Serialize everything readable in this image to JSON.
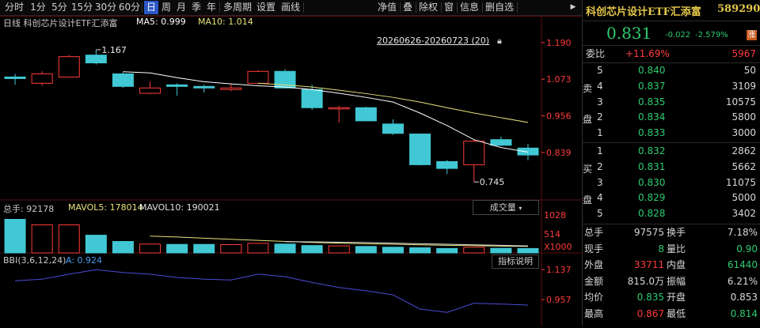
{
  "toolbar": {
    "left_items": [
      "分时",
      "1分",
      "5分",
      "15分",
      "30分",
      "60分",
      "日",
      "周",
      "月",
      "季",
      "年",
      "多周期",
      "设置",
      "画线"
    ],
    "active": "日",
    "right_items": [
      "净值",
      "叠",
      "除权",
      "窗",
      "信息",
      "删自选"
    ]
  },
  "legend_main": {
    "name": "日线  科创芯片设计ETF汇添富",
    "ma5_label": "MA5: 0.999",
    "ma10_label": "MA10: 1.014"
  },
  "date_range": "20260626-20260723 (20)",
  "price_axis": {
    "ticks": [
      "1.190",
      "1.073",
      "0.956",
      "0.839"
    ]
  },
  "annotations": {
    "high": "1.167",
    "low": "0.745"
  },
  "legend_volume": {
    "total": "总手: 92178",
    "mavol5": "MAVOL5: 178014",
    "mavol10": "MAVOL10: 190021"
  },
  "volume_button": "成交量",
  "volume_axis": {
    "ticks": [
      "1028",
      "514",
      "X1000"
    ]
  },
  "legend_bbi": {
    "label": "BBI(3,6,12,24)",
    "value": "A: 0.924"
  },
  "bbi_button": "指标说明",
  "bbi_axis": {
    "ticks": [
      "1.137",
      "0.957"
    ]
  },
  "colors": {
    "up": "#ff3b3b",
    "down": "#41c8d4",
    "ma5": "#ffffff",
    "ma10": "#e6e27a",
    "bbi": "#4b4bd8",
    "axis_red": "#ff3b3b"
  },
  "chart_data": [
    {
      "type": "candlestick",
      "title": "",
      "ylim": [
        0.7,
        1.23
      ],
      "candles": [
        {
          "open": 1.08,
          "close": 1.075,
          "high": 1.09,
          "low": 1.055
        },
        {
          "open": 1.06,
          "close": 1.09,
          "high": 1.098,
          "low": 1.052
        },
        {
          "open": 1.08,
          "close": 1.145,
          "high": 1.15,
          "low": 1.08
        },
        {
          "open": 1.15,
          "close": 1.125,
          "high": 1.167,
          "low": 1.12
        },
        {
          "open": 1.09,
          "close": 1.05,
          "high": 1.095,
          "low": 1.045
        },
        {
          "open": 1.028,
          "close": 1.045,
          "high": 1.065,
          "low": 1.025
        },
        {
          "open": 1.055,
          "close": 1.05,
          "high": 1.06,
          "low": 1.02
        },
        {
          "open": 1.05,
          "close": 1.045,
          "high": 1.055,
          "low": 1.03
        },
        {
          "open": 1.04,
          "close": 1.045,
          "high": 1.06,
          "low": 1.035
        },
        {
          "open": 1.06,
          "close": 1.098,
          "high": 1.102,
          "low": 1.06
        },
        {
          "open": 1.098,
          "close": 1.045,
          "high": 1.105,
          "low": 1.045
        },
        {
          "open": 1.04,
          "close": 0.982,
          "high": 1.055,
          "low": 0.975
        },
        {
          "open": 0.978,
          "close": 0.982,
          "high": 0.988,
          "low": 0.935
        },
        {
          "open": 0.982,
          "close": 0.94,
          "high": 0.985,
          "low": 0.94
        },
        {
          "open": 0.93,
          "close": 0.9,
          "high": 0.945,
          "low": 0.895
        },
        {
          "open": 0.898,
          "close": 0.8,
          "high": 0.9,
          "low": 0.798
        },
        {
          "open": 0.81,
          "close": 0.788,
          "high": 0.815,
          "low": 0.77
        },
        {
          "open": 0.8,
          "close": 0.875,
          "high": 0.88,
          "low": 0.745
        },
        {
          "open": 0.88,
          "close": 0.862,
          "high": 0.89,
          "low": 0.86
        },
        {
          "open": 0.853,
          "close": 0.831,
          "high": 0.867,
          "low": 0.814
        }
      ],
      "ma5": [
        1.08,
        1.078,
        1.08,
        1.087,
        1.097,
        1.093,
        1.078,
        1.065,
        1.058,
        1.052,
        1.048,
        1.04,
        1.028,
        1.015,
        1.0,
        0.965,
        0.925,
        0.88,
        0.855,
        0.84
      ],
      "ma10": [
        1.09,
        1.089,
        1.087,
        1.085,
        1.083,
        1.08,
        1.075,
        1.07,
        1.065,
        1.06,
        1.055,
        1.048,
        1.038,
        1.027,
        1.015,
        1.0,
        0.982,
        0.965,
        0.95,
        0.935
      ]
    },
    {
      "type": "bar",
      "title": "",
      "ylim": [
        0,
        1028
      ],
      "values": [
        910,
        760,
        760,
        480,
        310,
        240,
        230,
        230,
        225,
        260,
        240,
        200,
        190,
        175,
        155,
        140,
        120,
        150,
        125,
        120
      ],
      "mavol5": [
        560,
        540,
        520,
        500,
        480,
        455,
        430,
        400,
        370,
        340,
        310,
        285,
        265,
        250,
        235,
        220,
        205,
        195,
        185,
        178
      ],
      "mavol10": [
        null,
        null,
        null,
        null,
        null,
        null,
        null,
        null,
        null,
        null,
        305,
        300,
        290,
        280,
        265,
        250,
        235,
        220,
        205,
        190
      ]
    },
    {
      "type": "line",
      "title": "",
      "ylim": [
        0.8,
        1.2
      ],
      "bbi": [
        1.07,
        1.08,
        1.11,
        1.137,
        1.12,
        1.11,
        1.09,
        1.08,
        1.075,
        1.11,
        1.095,
        1.06,
        1.03,
        1.01,
        0.985,
        0.9,
        0.88,
        0.935,
        0.93,
        0.924
      ]
    }
  ],
  "quote": {
    "title": "科创芯片设计ETF汇添富",
    "code": "589290",
    "price": "0.831",
    "change": "-0.022",
    "change_pct": "-2.579%",
    "flag": "涨",
    "weibi_label": "委比",
    "weibi_pct": "+11.69%",
    "weibi_val": "5967",
    "sell_label": [
      "卖",
      "盘"
    ],
    "buy_label": [
      "买",
      "盘"
    ],
    "asks": [
      {
        "n": "5",
        "p": "0.840",
        "v": "50"
      },
      {
        "n": "4",
        "p": "0.837",
        "v": "3109"
      },
      {
        "n": "3",
        "p": "0.835",
        "v": "10575"
      },
      {
        "n": "2",
        "p": "0.834",
        "v": "5800"
      },
      {
        "n": "1",
        "p": "0.833",
        "v": "3000"
      }
    ],
    "bids": [
      {
        "n": "1",
        "p": "0.832",
        "v": "2862"
      },
      {
        "n": "2",
        "p": "0.831",
        "v": "5662"
      },
      {
        "n": "3",
        "p": "0.830",
        "v": "11075"
      },
      {
        "n": "4",
        "p": "0.829",
        "v": "5000"
      },
      {
        "n": "5",
        "p": "0.828",
        "v": "3402"
      }
    ],
    "stats": [
      {
        "l1": "总手",
        "v1": "97575",
        "l2": "换手",
        "v2": "7.18%",
        "c1": "w",
        "c2": "w"
      },
      {
        "l1": "现手",
        "v1": "8",
        "l2": "量比",
        "v2": "0.90",
        "c1": "g",
        "c2": "g"
      },
      {
        "l1": "外盘",
        "v1": "33711",
        "l2": "内盘",
        "v2": "61440",
        "c1": "r",
        "c2": "g"
      },
      {
        "l1": "金额",
        "v1": "815.0万",
        "l2": "振幅",
        "v2": "6.21%",
        "c1": "w",
        "c2": "w"
      },
      {
        "l1": "均价",
        "v1": "0.835",
        "l2": "开盘",
        "v2": "0.853",
        "c1": "g",
        "c2": "w"
      },
      {
        "l1": "最高",
        "v1": "0.867",
        "l2": "最低",
        "v2": "0.814",
        "c1": "r",
        "c2": "g"
      }
    ]
  }
}
